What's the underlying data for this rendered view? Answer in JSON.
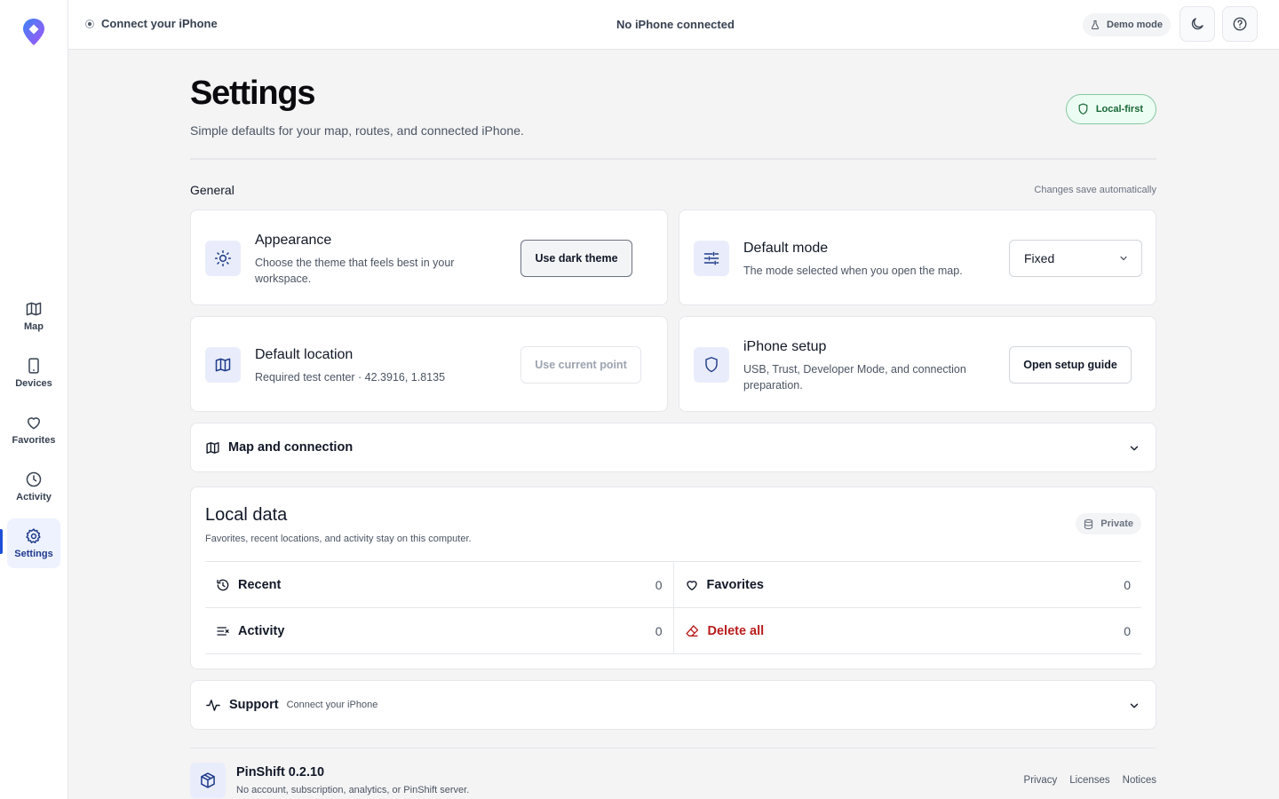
{
  "colors": {
    "accent": "#1d4ed8",
    "success": "#166534",
    "danger": "#b91c1c"
  },
  "sidebar": {
    "items": [
      {
        "label": "Map",
        "icon": "map-icon"
      },
      {
        "label": "Devices",
        "icon": "phone-icon"
      },
      {
        "label": "Favorites",
        "icon": "heart-icon"
      },
      {
        "label": "Activity",
        "icon": "clock-icon"
      },
      {
        "label": "Settings",
        "icon": "gear-icon",
        "active": true
      }
    ]
  },
  "topbar": {
    "connect_label": "Connect your iPhone",
    "status": "No iPhone connected",
    "demo_label": "Demo mode"
  },
  "page": {
    "title": "Settings",
    "subtitle": "Simple defaults for your map, routes, and connected iPhone.",
    "badge": "Local-first"
  },
  "general": {
    "label": "General",
    "note": "Changes save automatically",
    "appearance": {
      "title": "Appearance",
      "desc": "Choose the theme that feels best in your workspace.",
      "button": "Use dark theme"
    },
    "default_mode": {
      "title": "Default mode",
      "desc": "The mode selected when you open the map.",
      "selected": "Fixed"
    },
    "default_location": {
      "title": "Default location",
      "desc": "Required test center · 42.3916, 1.8135",
      "button": "Use current point"
    },
    "iphone_setup": {
      "title": "iPhone setup",
      "desc": "USB, Trust, Developer Mode, and connection preparation.",
      "button": "Open setup guide"
    }
  },
  "map_connection": {
    "title": "Map and connection"
  },
  "local_data": {
    "title": "Local data",
    "desc": "Favorites, recent locations, and activity stay on this computer.",
    "badge": "Private",
    "rows": [
      {
        "label": "Recent",
        "value": "0"
      },
      {
        "label": "Favorites",
        "value": "0"
      },
      {
        "label": "Activity",
        "value": "0"
      },
      {
        "label": "Delete all",
        "value": "0"
      }
    ]
  },
  "support": {
    "title": "Support",
    "subtitle": "Connect your iPhone"
  },
  "footer": {
    "app_name": "PinShift 0.2.10",
    "desc": "No account, subscription, analytics, or PinShift server.",
    "links": [
      "Privacy",
      "Licenses",
      "Notices"
    ]
  }
}
